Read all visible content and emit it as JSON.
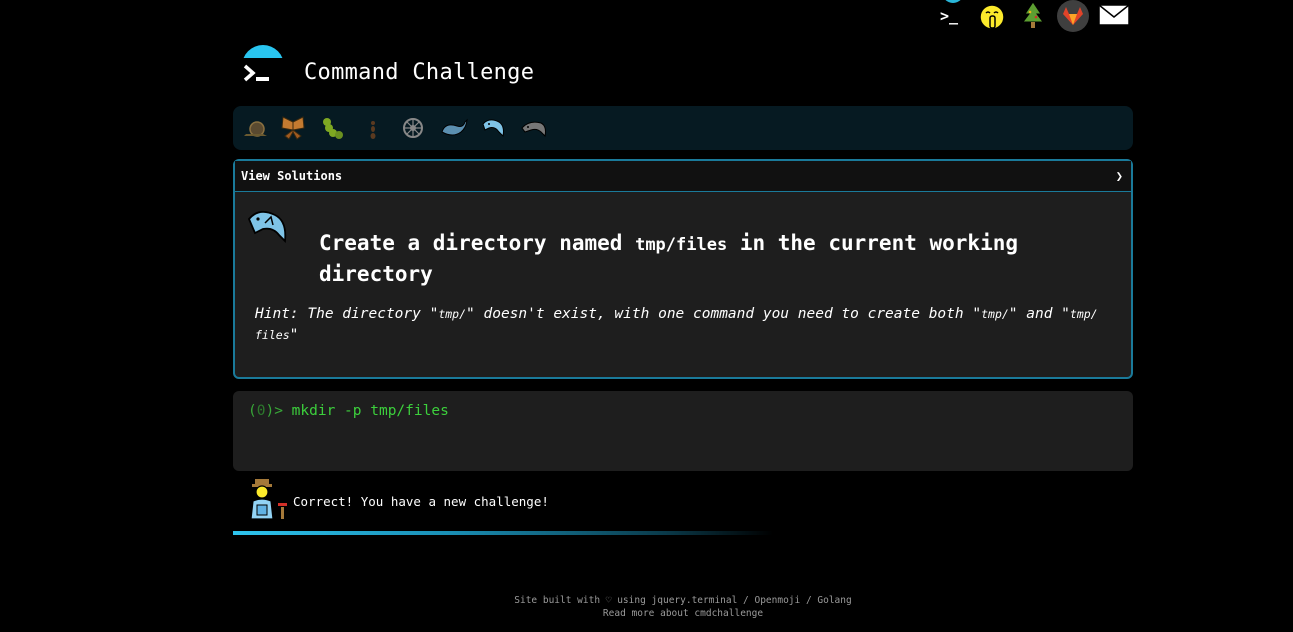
{
  "header": {
    "title": "Command Challenge",
    "logo_prompt": ">_"
  },
  "top_icons": [
    "home-prompt-icon",
    "shush-face-icon",
    "christmas-tree-icon",
    "gitlab-fox-icon",
    "mail-envelope-icon"
  ],
  "badges": [
    "snail-icon",
    "butterfly-icon",
    "caterpillar-icon",
    "ant-icon",
    "wheel-icon",
    "whale-icon",
    "dolphin-icon",
    "dolphin-icon"
  ],
  "panel": {
    "view_solutions": "View Solutions",
    "arrow": "❯",
    "challenge_icon": "dolphin-icon",
    "title_a": "Create a directory named ",
    "title_code": "tmp/files",
    "title_b": " in the current working directory",
    "hint_a": "Hint: The directory \"",
    "hint_code1": "tmp/",
    "hint_b": "\" doesn't exist, with one command you need to create both \"",
    "hint_code2": "tmp/",
    "hint_c": "\" and \"",
    "hint_code3": "tmp/ files",
    "hint_d": "\""
  },
  "terminal": {
    "prompt_open": "(",
    "prompt_num": "0",
    "prompt_close": ")> ",
    "command": "mkdir -p tmp/files"
  },
  "result": {
    "message": "Correct! You have a new challenge!",
    "avatar": "farmer-icon"
  },
  "footer": {
    "line1": "Site built with ♡ using jquery.terminal / Openmoji / Golang",
    "line2": "Read more about cmdchallenge"
  },
  "colors": {
    "accent": "#29c5f0",
    "panel_border": "#1a7a9a",
    "terminal_green": "#3ccf3c"
  }
}
